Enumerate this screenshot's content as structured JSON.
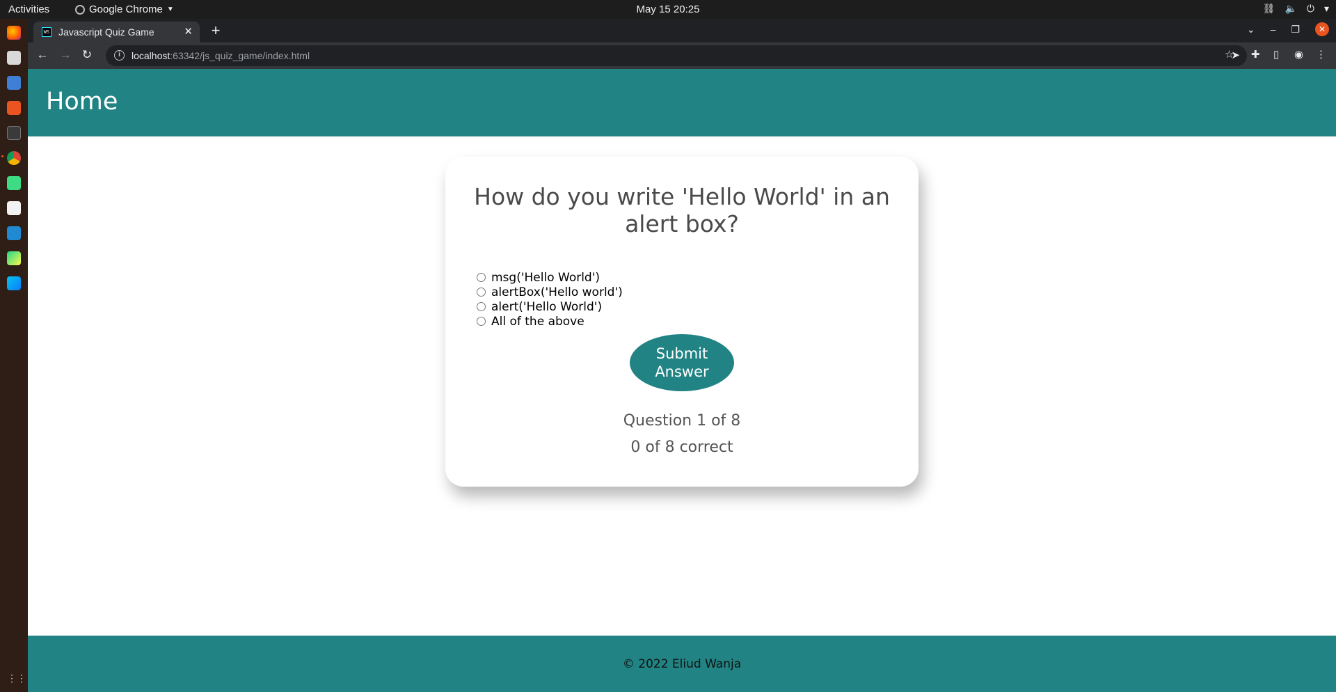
{
  "os": {
    "activities_label": "Activities",
    "app_name": "Google Chrome",
    "clock": "May 15  20:25",
    "tray": [
      "network-icon",
      "volume-icon",
      "power-icon",
      "system-menu-caret-icon"
    ]
  },
  "dock": {
    "items": [
      "firefox-icon",
      "files-icon",
      "text-editor-icon",
      "software-center-icon",
      "terminal-icon",
      "chrome-icon",
      "android-studio-icon",
      "text-editor-2-icon",
      "vscode-icon",
      "pycharm-icon",
      "webstorm-icon"
    ],
    "show_apps_icon": "show-apps-icon"
  },
  "browser": {
    "tab_title": "Javascript Quiz Game",
    "tab_favicon_text": "WS",
    "url_host": "localhost",
    "url_path": ":63342/js_quiz_game/index.html"
  },
  "page": {
    "header_link": "Home",
    "question": "How do you write 'Hello World' in an alert box?",
    "answers": [
      "msg('Hello World')",
      "alertBox('Hello world')",
      "alert('Hello World')",
      "All of the above"
    ],
    "submit_label": "Submit Answer",
    "progress_text": "Question 1 of 8",
    "score_text": "0 of 8 correct",
    "footer_text": "© 2022 Eliud Wanja"
  },
  "colors": {
    "brand_teal": "#218383",
    "chrome_dark": "#202124",
    "chrome_toolbar": "#35363a",
    "dock_bg": "#2e1e16",
    "ubuntu_orange": "#e95420"
  }
}
